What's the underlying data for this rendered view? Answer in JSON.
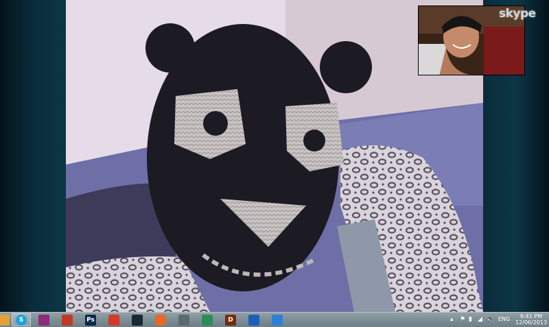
{
  "app": {
    "name": "Skype",
    "logo_text": "skype"
  },
  "call": {
    "remote_feed": "remote-video",
    "local_feed": "self-view-video"
  },
  "taskbar": {
    "apps": [
      {
        "name": "show-desktop",
        "icon": "folder-icon",
        "color": "#e2a13a",
        "label": ""
      },
      {
        "name": "skype",
        "icon": "skype-icon",
        "color": "#1aa3e0",
        "label": "S",
        "active": true
      },
      {
        "name": "winrar",
        "icon": "winrar-icon",
        "color": "#8b2d7a",
        "label": ""
      },
      {
        "name": "app-red",
        "icon": "red-arrow-icon",
        "color": "#c0392b",
        "label": ""
      },
      {
        "name": "photoshop",
        "icon": "photoshop-icon",
        "color": "#0b2a4a",
        "label": "Ps"
      },
      {
        "name": "ccleaner",
        "icon": "ccleaner-icon",
        "color": "#d23b2a",
        "label": ""
      },
      {
        "name": "steam",
        "icon": "steam-icon",
        "color": "#1b2838",
        "label": ""
      },
      {
        "name": "firefox",
        "icon": "firefox-icon",
        "color": "#e66a1f",
        "label": ""
      },
      {
        "name": "alien",
        "icon": "alien-icon",
        "color": "#5a6a6e",
        "label": ""
      },
      {
        "name": "window-app",
        "icon": "window-icon",
        "color": "#2e8b57",
        "label": ""
      },
      {
        "name": "diablo",
        "icon": "diablo-icon",
        "color": "#7a2a0a",
        "label": "D"
      },
      {
        "name": "crown-app",
        "icon": "crown-icon",
        "color": "#1c5fb8",
        "label": ""
      },
      {
        "name": "itunes",
        "icon": "itunes-icon",
        "color": "#2f7fd6",
        "label": ""
      }
    ],
    "tray": {
      "language": "ENG",
      "time": "9:41 PM",
      "date": "12/06/2013"
    }
  }
}
